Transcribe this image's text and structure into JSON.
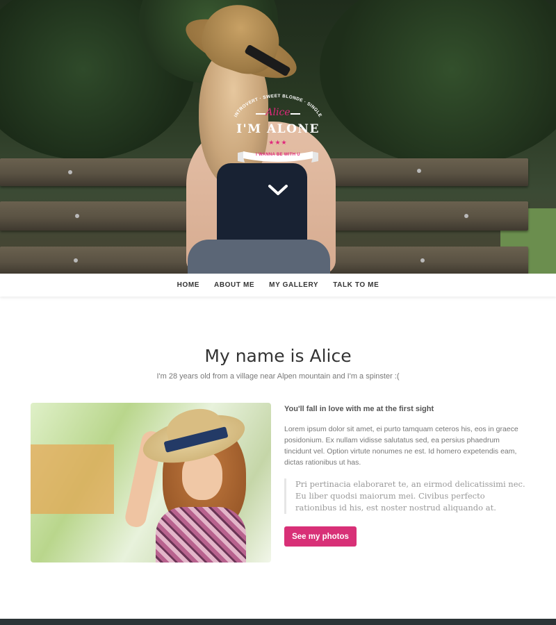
{
  "hero": {
    "badge_arc_text": "INTROVERT · SWEET BLONDE · SINGLE",
    "badge_name": "Alice",
    "badge_title": "I'M ALONE",
    "badge_stars": "★★★",
    "badge_ribbon_text": "I WANNA BE WITH U",
    "scroll_icon": "chevron-down-icon"
  },
  "nav": {
    "items": [
      {
        "label": "HOME"
      },
      {
        "label": "ABOUT ME"
      },
      {
        "label": "MY GALLERY"
      },
      {
        "label": "TALK TO ME"
      }
    ]
  },
  "about": {
    "title": "My name is Alice",
    "subtitle": "I'm 28 years old from a village near Alpen mountain and I'm a spinster :(",
    "heading": "You'll fall in love with me at the first sight",
    "paragraph": "Lorem ipsum dolor sit amet, ei purto tamquam ceteros his, eos in graece posidonium. Ex nullam vidisse salutatus sed, ea persius phaedrum tincidunt vel. Option virtute nonumes ne est. Id homero expetendis eam, dictas rationibus ut has.",
    "quote": "Pri pertinacia elaboraret te, an eirmod delicatissimi nec. Eu liber quodsi maiorum mei. Civibus perfecto rationibus id his, est noster nostrud aliquando at.",
    "button_label": "See my photos"
  },
  "colors": {
    "accent": "#d83077",
    "footer": "#2b3336"
  }
}
